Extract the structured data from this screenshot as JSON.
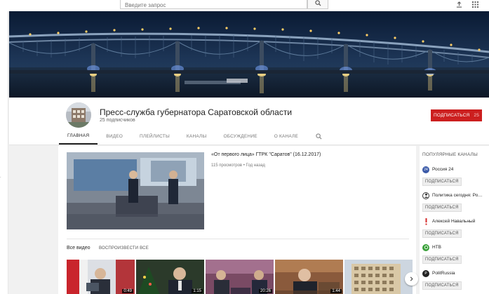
{
  "topbar": {
    "search_placeholder": "Введите запрос",
    "icons": [
      "search-icon",
      "upload-icon",
      "apps-grid-icon"
    ]
  },
  "channel": {
    "title": "Пресс-служба губернатора Саратовской области",
    "subscribers": "25 подписчиков",
    "subscribe_label": "ПОДПИСАТЬСЯ",
    "subscribe_count": "25"
  },
  "tabs": [
    {
      "label": "ГЛАВНАЯ",
      "active": true
    },
    {
      "label": "ВИДЕО",
      "active": false
    },
    {
      "label": "ПЛЕЙЛИСТЫ",
      "active": false
    },
    {
      "label": "КАНАЛЫ",
      "active": false
    },
    {
      "label": "ОБСУЖДЕНИЕ",
      "active": false
    },
    {
      "label": "О КАНАЛЕ",
      "active": false
    }
  ],
  "featured": {
    "title": "«От первого лица» ГТРК \"Саратов\" (16.12.2017)",
    "meta": "115 просмотров • Год назад"
  },
  "all_videos": {
    "title": "Все видео",
    "play_all": "ВОСПРОИЗВЕСТИ ВСЕ",
    "durations": [
      "0:49",
      "1:15",
      "20:26",
      "1:44",
      ""
    ]
  },
  "popular": {
    "title": "ПОПУЛЯРНЫЕ КАНАЛЫ",
    "subscribe_label": "ПОДПИСАТЬСЯ",
    "channels": [
      {
        "name": "Россия 24",
        "icon_color": "#3b5aa8"
      },
      {
        "name": "Политика сегодня: Ро…",
        "icon_color": "#333333"
      },
      {
        "name": "Алексей Навальный",
        "icon_color": "#d42a2a"
      },
      {
        "name": "НТВ",
        "icon_color": "#3aa13a"
      },
      {
        "name": "PolitRussia",
        "icon_color": "#222222"
      }
    ]
  },
  "colors": {
    "subscribe_red": "#cc1f1f",
    "banner_night": "#0b1b34"
  }
}
